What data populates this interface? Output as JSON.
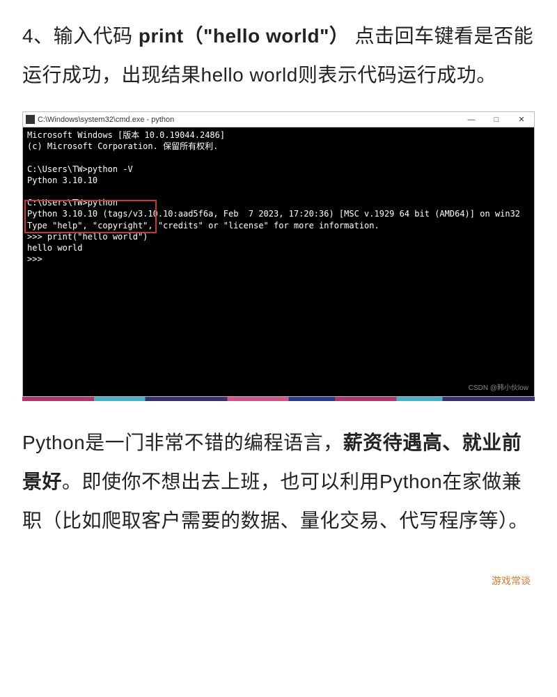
{
  "para1": {
    "prefix": "4、输入代码 ",
    "code": "print（\"hello world\"）",
    "suffix": " 点击回车键看是否能运行成功，出现结果hello world则表示代码运行成功。"
  },
  "window": {
    "title": "C:\\Windows\\system32\\cmd.exe - python",
    "controls": {
      "min": "—",
      "max": "□",
      "close": "✕"
    }
  },
  "term": {
    "l1": "Microsoft Windows [版本 10.0.19044.2486]",
    "l2": "(c) Microsoft Corporation. 保留所有权利.",
    "blank": "",
    "l3": "C:\\Users\\TW>python -V",
    "l4": "Python 3.10.10",
    "l5": "C:\\Users\\TW>python",
    "l6": "Python 3.10.10 (tags/v3.10.10:aad5f6a, Feb  7 2023, 17:20:36) [MSC v.1929 64 bit (AMD64)] on win32",
    "l7": "Type \"help\", \"copyright\", \"credits\" or \"license\" for more information.",
    "l8": ">>> print(\"hello world\")",
    "l9": "hello world",
    "l10": ">>>"
  },
  "watermark": "CSDN @韩小伙low",
  "para2": {
    "p1": "Python是一门非常不错的编程语言，",
    "bold": "薪资待遇高、就业前景好",
    "p2": "。即使你不想出去上班，也可以利用Python在家做兼职（比如爬取客户需要的数据、量化交易、代写程序等）。"
  },
  "footer_mark": "游戏常谈"
}
